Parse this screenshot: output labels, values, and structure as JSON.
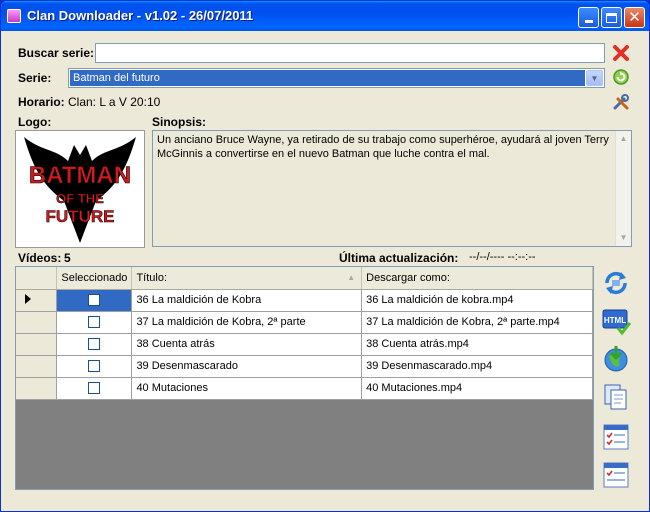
{
  "window": {
    "title": "Clan Downloader - v1.02 - 26/07/2011"
  },
  "form": {
    "search_label": "Buscar serie:",
    "search_value": "",
    "serie_label": "Serie:",
    "serie_value": "Batman del futuro",
    "horario_label": "Horario:",
    "horario_value": "Clan: L a V 20:10",
    "logo_label": "Logo:",
    "sinopsis_label": "Sinopsis:",
    "sinopsis_text": "Un anciano Bruce Wayne, ya retirado de su trabajo como superhéroe, ayudará al joven Terry McGinnis a convertirse en el nuevo Batman que luche contra el mal."
  },
  "logo": {
    "line1": "BATMAN",
    "line2": "OF THE",
    "line3": "FUTURE"
  },
  "status": {
    "videos_label": "Vídeos:",
    "videos_count": "5",
    "last_update_label": "Última actualización:",
    "last_update_value": "--/--/---- --:--:--"
  },
  "table": {
    "columns": [
      "Seleccionado",
      "Título:",
      "Descargar como:"
    ],
    "rows": [
      {
        "title": "36 La maldición de Kobra",
        "filename": "36 La maldición de kobra.mp4"
      },
      {
        "title": "37 La maldición de Kobra, 2ª parte",
        "filename": "37 La maldición de Kobra, 2ª parte.mp4"
      },
      {
        "title": "38 Cuenta atrás",
        "filename": "38 Cuenta atrás.mp4"
      },
      {
        "title": "39 Desenmascarado",
        "filename": "39 Desenmascarado.mp4"
      },
      {
        "title": "40 Mutaciones",
        "filename": "40 Mutaciones.mp4"
      }
    ]
  },
  "colors": {
    "titlebar": "#0054e3",
    "selection": "#316ac5",
    "window_bg": "#ece9d8"
  },
  "icons": [
    "clear-search-icon",
    "refresh-icon",
    "settings-tools-icon",
    "refresh-list-icon",
    "html-export-icon",
    "download-globe-icon",
    "copy-icon",
    "select-all-icon",
    "select-none-icon"
  ]
}
